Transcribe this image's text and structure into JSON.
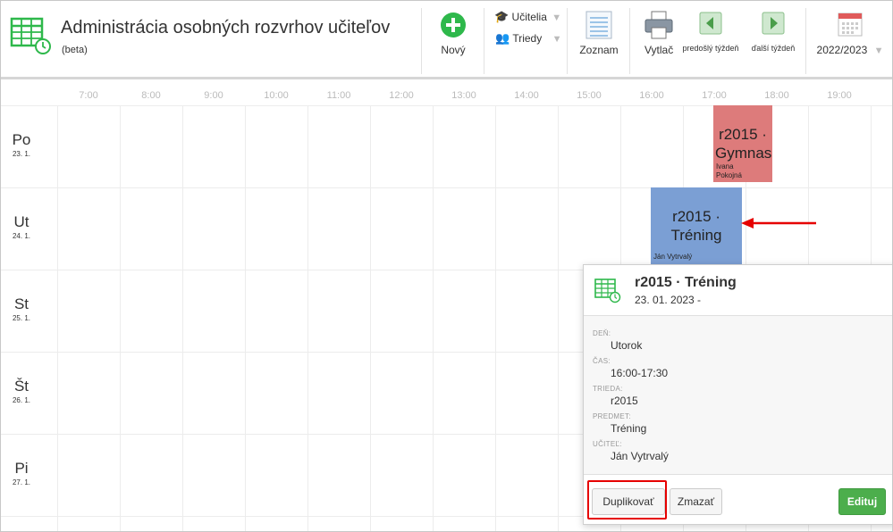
{
  "header": {
    "title": "Administrácia osobných rozvrhov učiteľov",
    "subtitle": "(beta)",
    "new_label": "Nový",
    "filter_teachers": "Učitelia",
    "filter_classes": "Triedy",
    "list_label": "Zoznam",
    "print_label": "Vytlač",
    "prev_week_label": "predošlý týždeň",
    "next_week_label": "ďalší týždeň",
    "school_year": "2022/2023"
  },
  "times": [
    "7:00",
    "8:00",
    "9:00",
    "10:00",
    "11:00",
    "12:00",
    "13:00",
    "14:00",
    "15:00",
    "16:00",
    "17:00",
    "18:00",
    "19:00"
  ],
  "days": [
    {
      "name": "Po",
      "date": "23. 1."
    },
    {
      "name": "Ut",
      "date": "24. 1."
    },
    {
      "name": "St",
      "date": "25. 1."
    },
    {
      "name": "Št",
      "date": "26. 1."
    },
    {
      "name": "Pi",
      "date": "27. 1."
    }
  ],
  "events": [
    {
      "title_line1": "r2015 ·",
      "title_line2": "Gymnas",
      "teacher": "Ivana Pokojná",
      "color": "#dd7b7b"
    },
    {
      "title_line1": "r2015 ·",
      "title_line2": "Tréning",
      "teacher": "Ján Vytrvalý",
      "color": "#7b9fd4"
    }
  ],
  "popover": {
    "title": "r2015 · Tréning",
    "date": "23. 01. 2023 -",
    "fields": [
      {
        "label": "Deň:",
        "value": "Utorok"
      },
      {
        "label": "Čas:",
        "value": "16:00-17:30"
      },
      {
        "label": "Trieda:",
        "value": "r2015"
      },
      {
        "label": "Predmet:",
        "value": "Tréning"
      },
      {
        "label": "Učiteľ:",
        "value": "Ján Vytrvalý"
      }
    ],
    "duplicate_label": "Duplikovať",
    "delete_label": "Zmazať",
    "edit_label": "Edituj"
  },
  "colors": {
    "accent_green": "#2eb84b",
    "success_button": "#4cae4c",
    "highlight_red": "#e60000"
  },
  "icons": [
    "schedule-calendar-icon",
    "plus-circle-icon",
    "graduation-cap-icon",
    "students-icon",
    "list-document-icon",
    "printer-icon",
    "arrow-left-icon",
    "arrow-right-icon",
    "calendar-icon"
  ]
}
